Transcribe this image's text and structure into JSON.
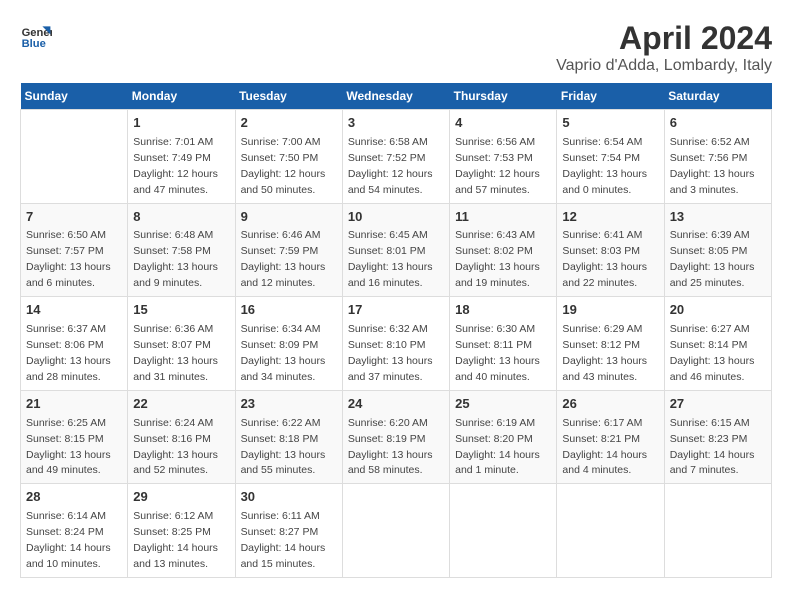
{
  "logo": {
    "line1": "General",
    "line2": "Blue"
  },
  "title": "April 2024",
  "subtitle": "Vaprio d'Adda, Lombardy, Italy",
  "days_of_week": [
    "Sunday",
    "Monday",
    "Tuesday",
    "Wednesday",
    "Thursday",
    "Friday",
    "Saturday"
  ],
  "weeks": [
    [
      {
        "day": "",
        "info": ""
      },
      {
        "day": "1",
        "info": "Sunrise: 7:01 AM\nSunset: 7:49 PM\nDaylight: 12 hours\nand 47 minutes."
      },
      {
        "day": "2",
        "info": "Sunrise: 7:00 AM\nSunset: 7:50 PM\nDaylight: 12 hours\nand 50 minutes."
      },
      {
        "day": "3",
        "info": "Sunrise: 6:58 AM\nSunset: 7:52 PM\nDaylight: 12 hours\nand 54 minutes."
      },
      {
        "day": "4",
        "info": "Sunrise: 6:56 AM\nSunset: 7:53 PM\nDaylight: 12 hours\nand 57 minutes."
      },
      {
        "day": "5",
        "info": "Sunrise: 6:54 AM\nSunset: 7:54 PM\nDaylight: 13 hours\nand 0 minutes."
      },
      {
        "day": "6",
        "info": "Sunrise: 6:52 AM\nSunset: 7:56 PM\nDaylight: 13 hours\nand 3 minutes."
      }
    ],
    [
      {
        "day": "7",
        "info": "Sunrise: 6:50 AM\nSunset: 7:57 PM\nDaylight: 13 hours\nand 6 minutes."
      },
      {
        "day": "8",
        "info": "Sunrise: 6:48 AM\nSunset: 7:58 PM\nDaylight: 13 hours\nand 9 minutes."
      },
      {
        "day": "9",
        "info": "Sunrise: 6:46 AM\nSunset: 7:59 PM\nDaylight: 13 hours\nand 12 minutes."
      },
      {
        "day": "10",
        "info": "Sunrise: 6:45 AM\nSunset: 8:01 PM\nDaylight: 13 hours\nand 16 minutes."
      },
      {
        "day": "11",
        "info": "Sunrise: 6:43 AM\nSunset: 8:02 PM\nDaylight: 13 hours\nand 19 minutes."
      },
      {
        "day": "12",
        "info": "Sunrise: 6:41 AM\nSunset: 8:03 PM\nDaylight: 13 hours\nand 22 minutes."
      },
      {
        "day": "13",
        "info": "Sunrise: 6:39 AM\nSunset: 8:05 PM\nDaylight: 13 hours\nand 25 minutes."
      }
    ],
    [
      {
        "day": "14",
        "info": "Sunrise: 6:37 AM\nSunset: 8:06 PM\nDaylight: 13 hours\nand 28 minutes."
      },
      {
        "day": "15",
        "info": "Sunrise: 6:36 AM\nSunset: 8:07 PM\nDaylight: 13 hours\nand 31 minutes."
      },
      {
        "day": "16",
        "info": "Sunrise: 6:34 AM\nSunset: 8:09 PM\nDaylight: 13 hours\nand 34 minutes."
      },
      {
        "day": "17",
        "info": "Sunrise: 6:32 AM\nSunset: 8:10 PM\nDaylight: 13 hours\nand 37 minutes."
      },
      {
        "day": "18",
        "info": "Sunrise: 6:30 AM\nSunset: 8:11 PM\nDaylight: 13 hours\nand 40 minutes."
      },
      {
        "day": "19",
        "info": "Sunrise: 6:29 AM\nSunset: 8:12 PM\nDaylight: 13 hours\nand 43 minutes."
      },
      {
        "day": "20",
        "info": "Sunrise: 6:27 AM\nSunset: 8:14 PM\nDaylight: 13 hours\nand 46 minutes."
      }
    ],
    [
      {
        "day": "21",
        "info": "Sunrise: 6:25 AM\nSunset: 8:15 PM\nDaylight: 13 hours\nand 49 minutes."
      },
      {
        "day": "22",
        "info": "Sunrise: 6:24 AM\nSunset: 8:16 PM\nDaylight: 13 hours\nand 52 minutes."
      },
      {
        "day": "23",
        "info": "Sunrise: 6:22 AM\nSunset: 8:18 PM\nDaylight: 13 hours\nand 55 minutes."
      },
      {
        "day": "24",
        "info": "Sunrise: 6:20 AM\nSunset: 8:19 PM\nDaylight: 13 hours\nand 58 minutes."
      },
      {
        "day": "25",
        "info": "Sunrise: 6:19 AM\nSunset: 8:20 PM\nDaylight: 14 hours\nand 1 minute."
      },
      {
        "day": "26",
        "info": "Sunrise: 6:17 AM\nSunset: 8:21 PM\nDaylight: 14 hours\nand 4 minutes."
      },
      {
        "day": "27",
        "info": "Sunrise: 6:15 AM\nSunset: 8:23 PM\nDaylight: 14 hours\nand 7 minutes."
      }
    ],
    [
      {
        "day": "28",
        "info": "Sunrise: 6:14 AM\nSunset: 8:24 PM\nDaylight: 14 hours\nand 10 minutes."
      },
      {
        "day": "29",
        "info": "Sunrise: 6:12 AM\nSunset: 8:25 PM\nDaylight: 14 hours\nand 13 minutes."
      },
      {
        "day": "30",
        "info": "Sunrise: 6:11 AM\nSunset: 8:27 PM\nDaylight: 14 hours\nand 15 minutes."
      },
      {
        "day": "",
        "info": ""
      },
      {
        "day": "",
        "info": ""
      },
      {
        "day": "",
        "info": ""
      },
      {
        "day": "",
        "info": ""
      }
    ]
  ]
}
